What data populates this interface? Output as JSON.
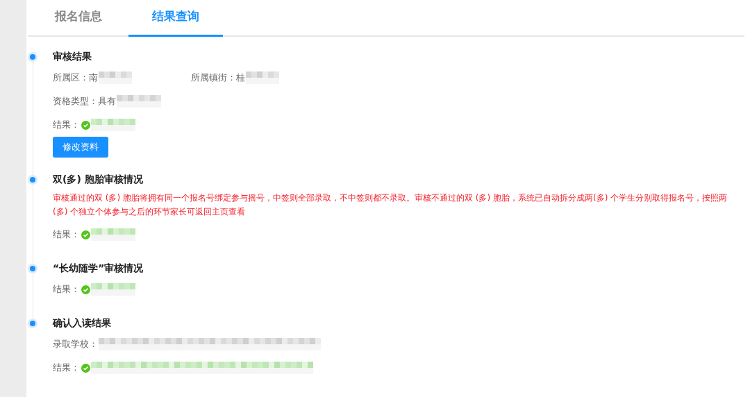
{
  "tabs": [
    {
      "label": "报名信息",
      "selected": false
    },
    {
      "label": "结果查询",
      "selected": true
    }
  ],
  "sections": [
    {
      "title": "审核结果",
      "rows": [
        [
          {
            "label": "所属区：",
            "value": "南",
            "kind": "short",
            "redacted": true
          },
          {
            "label": "所属镇街：",
            "value": "桂",
            "kind": "short",
            "redacted": true
          }
        ],
        [
          {
            "label": "资格类型：",
            "value": "具有",
            "kind": "medium",
            "redacted": true
          }
        ],
        [
          {
            "label": "结果：",
            "passed": true,
            "kind": "medium",
            "redacted": true
          }
        ]
      ],
      "button": "修改资料"
    },
    {
      "title": "双(多) 胞胎审核情况",
      "note": "审核通过的双 (多) 胞胎将拥有同一个报名号绑定参与摇号，中签则全部录取，不中签则都不录取。审核不通过的双 (多) 胞胎，系统已自动拆分成两(多) 个学生分别取得报名号，按照两(多) 个独立个体参与之后的环节家长可返回主页查看",
      "rows": [
        [
          {
            "label": "结果：",
            "passed": true,
            "kind": "medium",
            "redacted": true
          }
        ]
      ]
    },
    {
      "title": "“长幼随学”审核情况",
      "rows": [
        [
          {
            "label": "结果：",
            "passed": true,
            "kind": "medium",
            "redacted": true
          }
        ]
      ]
    },
    {
      "title": "确认入读结果",
      "rows": [
        [
          {
            "label": "录取学校：",
            "kind": "long",
            "redacted": true
          }
        ],
        [
          {
            "label": "结果：",
            "passed": true,
            "kind": "long",
            "redacted": true
          }
        ]
      ]
    }
  ]
}
